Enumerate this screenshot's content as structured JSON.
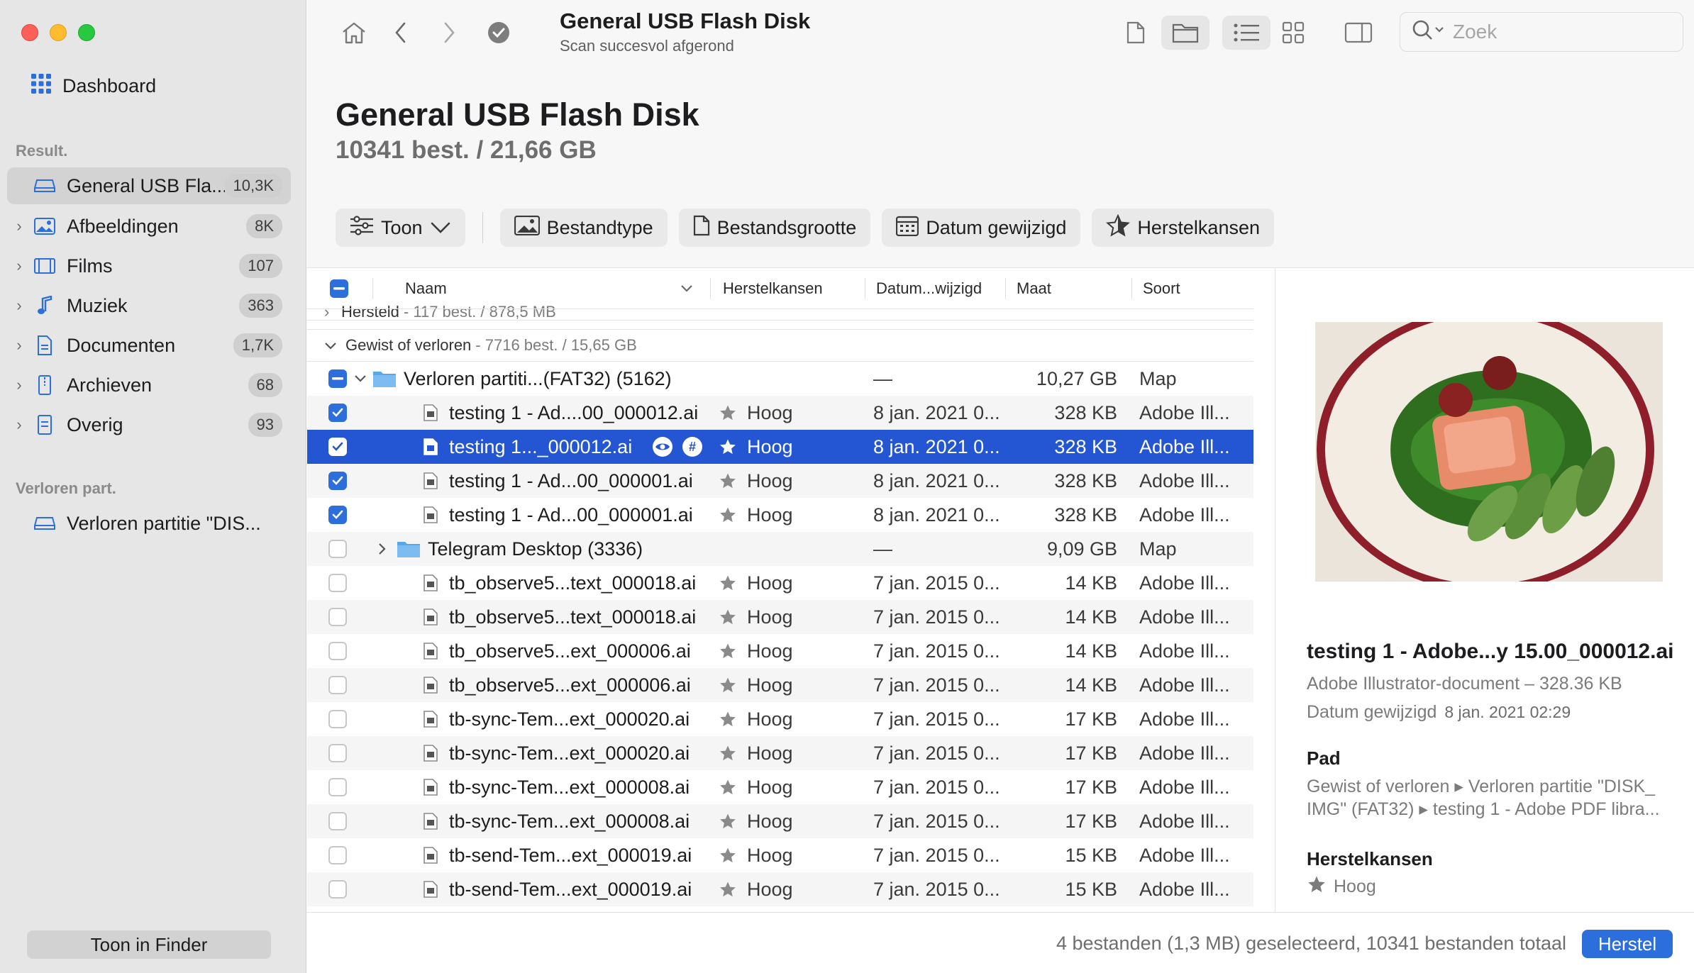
{
  "window": {
    "title": "General USB Flash Disk",
    "subtitle": "Scan succesvol afgerond"
  },
  "search": {
    "placeholder": "Zoek"
  },
  "sidebar": {
    "dashboard": "Dashboard",
    "results_header": "Result.",
    "items": [
      {
        "label": "General USB Fla...",
        "badge": "10,3K",
        "icon": "drive-icon"
      },
      {
        "label": "Afbeeldingen",
        "badge": "8K",
        "icon": "image-icon"
      },
      {
        "label": "Films",
        "badge": "107",
        "icon": "film-icon"
      },
      {
        "label": "Muziek",
        "badge": "363",
        "icon": "music-icon"
      },
      {
        "label": "Documenten",
        "badge": "1,7K",
        "icon": "document-icon"
      },
      {
        "label": "Archieven",
        "badge": "68",
        "icon": "archive-icon"
      },
      {
        "label": "Overig",
        "badge": "93",
        "icon": "other-icon"
      }
    ],
    "lost_header": "Verloren part.",
    "lost_item": "Verloren partitie \"DIS...",
    "finder_button": "Toon in Finder"
  },
  "header": {
    "title": "General USB Flash Disk",
    "summary": "10341 best. / 21,66 GB"
  },
  "filters": {
    "show": "Toon",
    "type": "Bestandtype",
    "size": "Bestandsgrootte",
    "date": "Datum gewijzigd",
    "chances": "Herstelkansen"
  },
  "table": {
    "columns": {
      "name": "Naam",
      "chances": "Herstelkansen",
      "date": "Datum...wijzigd",
      "size": "Maat",
      "kind": "Soort"
    },
    "group_restored": {
      "label": "Hersteld",
      "count": "- 117 best. / 878,5 MB"
    },
    "group_lost": {
      "label": "Gewist of verloren",
      "count": "- 7716 best. / 15,65 GB"
    },
    "rows": [
      {
        "name": "Verloren partiti...(FAT32) (5162)",
        "chance": "",
        "date": "—",
        "size": "10,27 GB",
        "kind": "Map",
        "folder": true,
        "indent": 0,
        "check": "mixed",
        "expanded": true
      },
      {
        "name": "testing 1 - Ad....00_000012.ai",
        "chance": "Hoog",
        "date": "8 jan. 2021 0...",
        "size": "328 KB",
        "kind": "Adobe Ill...",
        "check": "on"
      },
      {
        "name": "testing 1..._000012.ai",
        "chance": "Hoog",
        "date": "8 jan. 2021 0...",
        "size": "328 KB",
        "kind": "Adobe Ill...",
        "check": "on",
        "selected": true
      },
      {
        "name": "testing 1 - Ad...00_000001.ai",
        "chance": "Hoog",
        "date": "8 jan. 2021 0...",
        "size": "328 KB",
        "kind": "Adobe Ill...",
        "check": "on"
      },
      {
        "name": "testing 1 - Ad...00_000001.ai",
        "chance": "Hoog",
        "date": "8 jan. 2021 0...",
        "size": "328 KB",
        "kind": "Adobe Ill...",
        "check": "on"
      },
      {
        "name": "Telegram Desktop (3336)",
        "chance": "",
        "date": "—",
        "size": "9,09 GB",
        "kind": "Map",
        "folder": true,
        "indent": 1,
        "check": "off",
        "expanded": false
      },
      {
        "name": "tb_observe5...text_000018.ai",
        "chance": "Hoog",
        "date": "7 jan. 2015 0...",
        "size": "14 KB",
        "kind": "Adobe Ill...",
        "check": "off"
      },
      {
        "name": "tb_observe5...text_000018.ai",
        "chance": "Hoog",
        "date": "7 jan. 2015 0...",
        "size": "14 KB",
        "kind": "Adobe Ill...",
        "check": "off"
      },
      {
        "name": "tb_observe5...ext_000006.ai",
        "chance": "Hoog",
        "date": "7 jan. 2015 0...",
        "size": "14 KB",
        "kind": "Adobe Ill...",
        "check": "off"
      },
      {
        "name": "tb_observe5...ext_000006.ai",
        "chance": "Hoog",
        "date": "7 jan. 2015 0...",
        "size": "14 KB",
        "kind": "Adobe Ill...",
        "check": "off"
      },
      {
        "name": "tb-sync-Tem...ext_000020.ai",
        "chance": "Hoog",
        "date": "7 jan. 2015 0...",
        "size": "17 KB",
        "kind": "Adobe Ill...",
        "check": "off"
      },
      {
        "name": "tb-sync-Tem...ext_000020.ai",
        "chance": "Hoog",
        "date": "7 jan. 2015 0...",
        "size": "17 KB",
        "kind": "Adobe Ill...",
        "check": "off"
      },
      {
        "name": "tb-sync-Tem...ext_000008.ai",
        "chance": "Hoog",
        "date": "7 jan. 2015 0...",
        "size": "17 KB",
        "kind": "Adobe Ill...",
        "check": "off"
      },
      {
        "name": "tb-sync-Tem...ext_000008.ai",
        "chance": "Hoog",
        "date": "7 jan. 2015 0...",
        "size": "17 KB",
        "kind": "Adobe Ill...",
        "check": "off"
      },
      {
        "name": "tb-send-Tem...ext_000019.ai",
        "chance": "Hoog",
        "date": "7 jan. 2015 0...",
        "size": "15 KB",
        "kind": "Adobe Ill...",
        "check": "off"
      },
      {
        "name": "tb-send-Tem...ext_000019.ai",
        "chance": "Hoog",
        "date": "7 jan. 2015 0...",
        "size": "15 KB",
        "kind": "Adobe Ill...",
        "check": "off"
      }
    ]
  },
  "preview": {
    "name": "testing 1 - Adobe...y 15.00_000012.ai",
    "kind_size": "Adobe Illustrator-document – 328.36 KB",
    "date_label": "Datum gewijzigd",
    "date_value": "8 jan. 2021 02:29",
    "path_header": "Pad",
    "path_line1": "Gewist of verloren ▸ Verloren partitie \"DISK_",
    "path_line2": "IMG\" (FAT32) ▸ testing 1 - Adobe PDF libra...",
    "chances_header": "Herstelkansen",
    "chance_value": "Hoog"
  },
  "footer": {
    "status": "4 bestanden (1,3 MB) geselecteerd, 10341 bestanden totaal",
    "recover": "Herstel"
  },
  "colors": {
    "accent": "#2c6fdc",
    "selection": "#2456d3",
    "sidebar": "#e7e6e6"
  }
}
